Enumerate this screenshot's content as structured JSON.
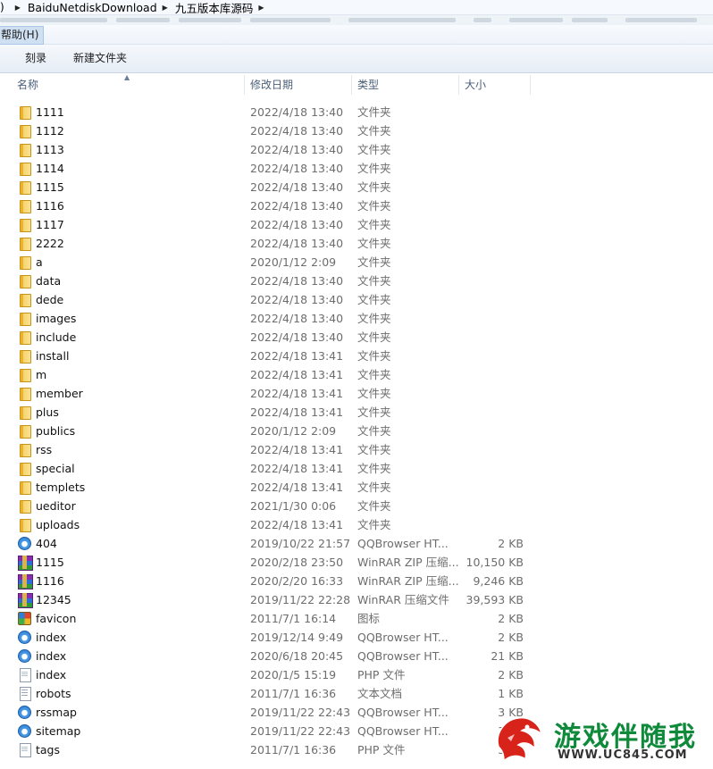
{
  "address": {
    "crumbs": [
      "BaiduNetdiskDownload",
      "九五版本库源码"
    ]
  },
  "menu": {
    "help": "帮助(H)"
  },
  "toolbar": {
    "burn": "刻录",
    "new_folder": "新建文件夹"
  },
  "columns": {
    "name": "名称",
    "date": "修改日期",
    "type": "类型",
    "size": "大小"
  },
  "files": [
    {
      "icon": "folder-icon",
      "name": "1111",
      "date": "2022/4/18 13:40",
      "type": "文件夹",
      "size": ""
    },
    {
      "icon": "folder-icon",
      "name": "1112",
      "date": "2022/4/18 13:40",
      "type": "文件夹",
      "size": ""
    },
    {
      "icon": "folder-icon",
      "name": "1113",
      "date": "2022/4/18 13:40",
      "type": "文件夹",
      "size": ""
    },
    {
      "icon": "folder-icon",
      "name": "1114",
      "date": "2022/4/18 13:40",
      "type": "文件夹",
      "size": ""
    },
    {
      "icon": "folder-icon",
      "name": "1115",
      "date": "2022/4/18 13:40",
      "type": "文件夹",
      "size": ""
    },
    {
      "icon": "folder-icon",
      "name": "1116",
      "date": "2022/4/18 13:40",
      "type": "文件夹",
      "size": ""
    },
    {
      "icon": "folder-icon",
      "name": "1117",
      "date": "2022/4/18 13:40",
      "type": "文件夹",
      "size": ""
    },
    {
      "icon": "folder-icon",
      "name": "2222",
      "date": "2022/4/18 13:40",
      "type": "文件夹",
      "size": ""
    },
    {
      "icon": "folder-icon",
      "name": "a",
      "date": "2020/1/12 2:09",
      "type": "文件夹",
      "size": ""
    },
    {
      "icon": "folder-icon",
      "name": "data",
      "date": "2022/4/18 13:40",
      "type": "文件夹",
      "size": ""
    },
    {
      "icon": "folder-icon",
      "name": "dede",
      "date": "2022/4/18 13:40",
      "type": "文件夹",
      "size": ""
    },
    {
      "icon": "folder-icon",
      "name": "images",
      "date": "2022/4/18 13:40",
      "type": "文件夹",
      "size": ""
    },
    {
      "icon": "folder-icon",
      "name": "include",
      "date": "2022/4/18 13:40",
      "type": "文件夹",
      "size": ""
    },
    {
      "icon": "folder-icon",
      "name": "install",
      "date": "2022/4/18 13:41",
      "type": "文件夹",
      "size": ""
    },
    {
      "icon": "folder-icon",
      "name": "m",
      "date": "2022/4/18 13:41",
      "type": "文件夹",
      "size": ""
    },
    {
      "icon": "folder-icon",
      "name": "member",
      "date": "2022/4/18 13:41",
      "type": "文件夹",
      "size": ""
    },
    {
      "icon": "folder-icon",
      "name": "plus",
      "date": "2022/4/18 13:41",
      "type": "文件夹",
      "size": ""
    },
    {
      "icon": "folder-icon",
      "name": "publics",
      "date": "2020/1/12 2:09",
      "type": "文件夹",
      "size": ""
    },
    {
      "icon": "folder-icon",
      "name": "rss",
      "date": "2022/4/18 13:41",
      "type": "文件夹",
      "size": ""
    },
    {
      "icon": "folder-icon",
      "name": "special",
      "date": "2022/4/18 13:41",
      "type": "文件夹",
      "size": ""
    },
    {
      "icon": "folder-icon",
      "name": "templets",
      "date": "2022/4/18 13:41",
      "type": "文件夹",
      "size": ""
    },
    {
      "icon": "folder-icon",
      "name": "ueditor",
      "date": "2021/1/30 0:06",
      "type": "文件夹",
      "size": ""
    },
    {
      "icon": "folder-icon",
      "name": "uploads",
      "date": "2022/4/18 13:41",
      "type": "文件夹",
      "size": ""
    },
    {
      "icon": "qqbrowser-icon",
      "name": "404",
      "date": "2019/10/22 21:57",
      "type": "QQBrowser HT...",
      "size": "2 KB"
    },
    {
      "icon": "winrar-icon",
      "name": "1115",
      "date": "2020/2/18 23:50",
      "type": "WinRAR ZIP 压缩...",
      "size": "10,150 KB"
    },
    {
      "icon": "winrar-icon",
      "name": "1116",
      "date": "2020/2/20 16:33",
      "type": "WinRAR ZIP 压缩...",
      "size": "9,246 KB"
    },
    {
      "icon": "winrar-icon",
      "name": "12345",
      "date": "2019/11/22 22:28",
      "type": "WinRAR 压缩文件",
      "size": "39,593 KB"
    },
    {
      "icon": "favicon-icon",
      "name": "favicon",
      "date": "2011/7/1 16:14",
      "type": "图标",
      "size": "2 KB"
    },
    {
      "icon": "qqbrowser-icon",
      "name": "index",
      "date": "2019/12/14 9:49",
      "type": "QQBrowser HT...",
      "size": "2 KB"
    },
    {
      "icon": "qqbrowser-icon",
      "name": "index",
      "date": "2020/6/18 20:45",
      "type": "QQBrowser HT...",
      "size": "21 KB"
    },
    {
      "icon": "php-file-icon",
      "name": "index",
      "date": "2020/1/5 15:19",
      "type": "PHP 文件",
      "size": "2 KB"
    },
    {
      "icon": "text-file-icon",
      "name": "robots",
      "date": "2011/7/1 16:36",
      "type": "文本文档",
      "size": "1 KB"
    },
    {
      "icon": "qqbrowser-icon",
      "name": "rssmap",
      "date": "2019/11/22 22:43",
      "type": "QQBrowser HT...",
      "size": "3 KB"
    },
    {
      "icon": "qqbrowser-icon",
      "name": "sitemap",
      "date": "2019/11/22 22:43",
      "type": "QQBrowser HT...",
      "size": "3 KB"
    },
    {
      "icon": "php-file-icon",
      "name": "tags",
      "date": "2011/7/1 16:36",
      "type": "PHP 文件",
      "size": "3 KB"
    }
  ],
  "watermark": {
    "title": "游戏伴随我",
    "url": "WWW.UC845.COM"
  },
  "colors": {
    "folder": "#f6d36b",
    "header_text": "#4c607a",
    "meta_text": "#6d6d6d",
    "watermark_green": "#0e8a3a"
  }
}
